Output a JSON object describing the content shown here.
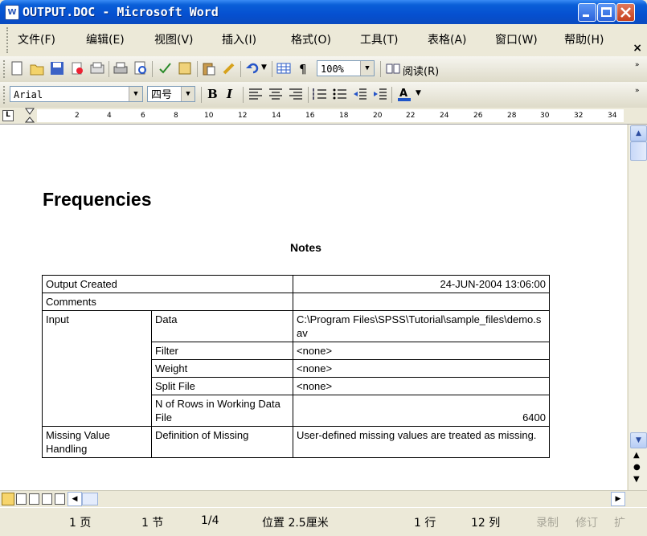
{
  "window": {
    "title": "OUTPUT.DOC - Microsoft Word",
    "app_icon": "W"
  },
  "menu": [
    "文件(F)",
    "编辑(E)",
    "视图(V)",
    "插入(I)",
    "格式(O)",
    "工具(T)",
    "表格(A)",
    "窗口(W)",
    "帮助(H)"
  ],
  "menu_close": "×",
  "toolbar": {
    "zoom": "100%",
    "read_label": "阅读(R)"
  },
  "format_bar": {
    "font": "Arial",
    "size": "四号",
    "bold": "B",
    "italic": "I"
  },
  "ruler_marks": [
    "2",
    "4",
    "6",
    "8",
    "10",
    "12",
    "14",
    "16",
    "18",
    "20",
    "22",
    "24",
    "26",
    "28",
    "30",
    "32",
    "34"
  ],
  "doc": {
    "heading": "Frequencies",
    "table_title": "Notes",
    "rows": {
      "output_created_label": "Output Created",
      "output_created_value": "24-JUN-2004 13:06:00",
      "comments_label": "Comments",
      "input_label": "Input",
      "data_label": "Data",
      "data_value": "C:\\Program Files\\SPSS\\Tutorial\\sample_files\\demo.sav",
      "filter_label": "Filter",
      "filter_value": "<none>",
      "weight_label": "Weight",
      "weight_value": "<none>",
      "split_label": "Split File",
      "split_value": "<none>",
      "nrows_label": "N of Rows in Working Data File",
      "nrows_value": "6400",
      "missing_label": "Missing Value Handling",
      "definition_label": "Definition of Missing",
      "definition_value": "User-defined missing values are treated as missing."
    }
  },
  "status": {
    "page": "1 页",
    "section": "1 节",
    "pages": "1/4",
    "position": "位置 2.5厘米",
    "line": "1 行",
    "column": "12 列",
    "rec": "录制",
    "trk": "修订",
    "ext": "扩"
  },
  "colors": {
    "title_bar": "#0550d0",
    "chrome": "#ece9d8"
  }
}
